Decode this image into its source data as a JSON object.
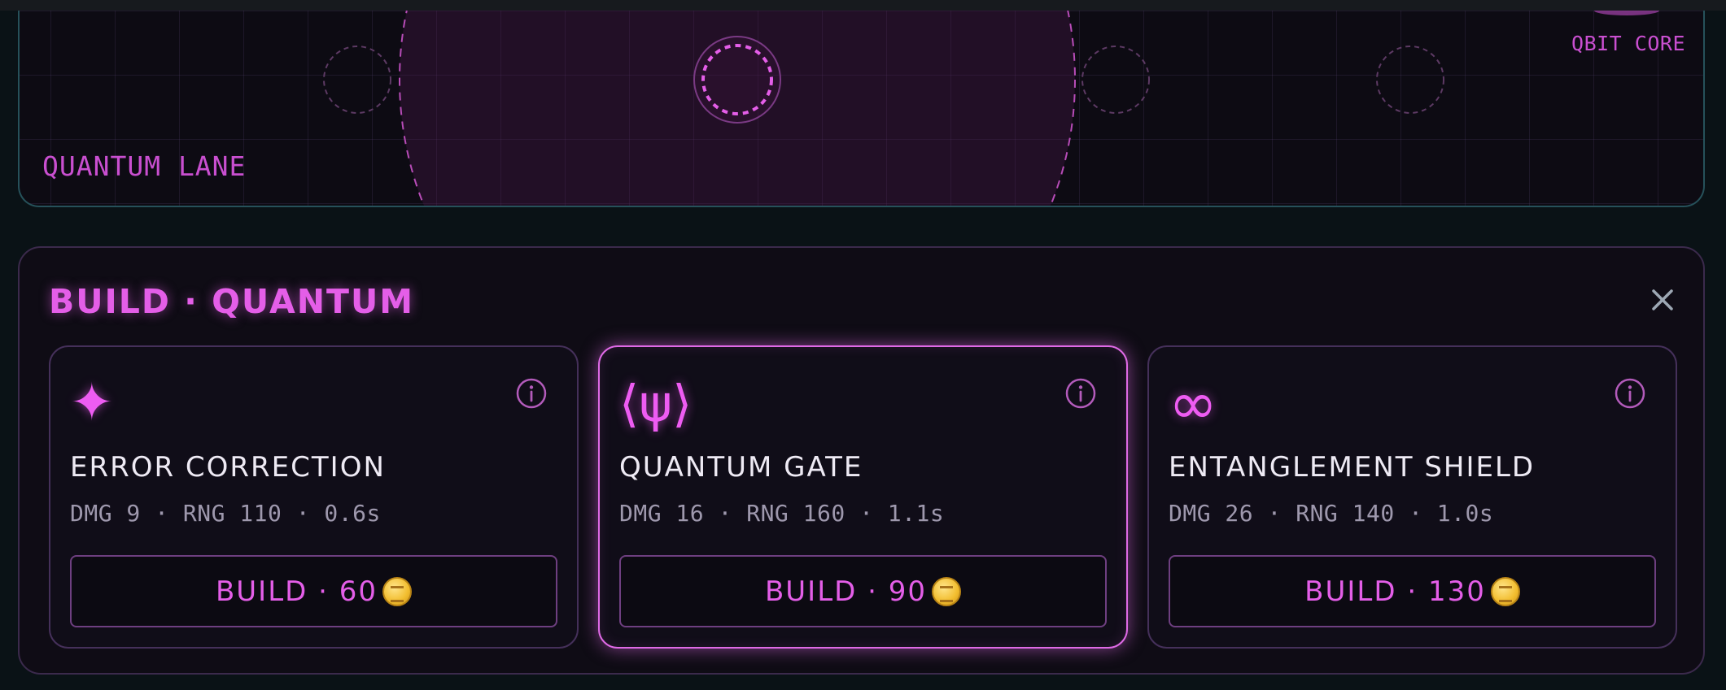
{
  "lane": {
    "label": "QUANTUM LANE",
    "core_label": "QBIT CORE"
  },
  "panel": {
    "title": "BUILD · QUANTUM",
    "close_icon": "close-icon",
    "cards": [
      {
        "icon": "✦",
        "icon_name": "sparkle-icon",
        "name": "ERROR CORRECTION",
        "stats": "DMG 9 · RNG 110 · 0.6s",
        "build_label": "BUILD · 60",
        "selected": false
      },
      {
        "icon": "⟨ψ⟩",
        "icon_name": "psi-ket-icon",
        "name": "QUANTUM GATE",
        "stats": "DMG 16 · RNG 160 · 1.1s",
        "build_label": "BUILD · 90",
        "selected": true
      },
      {
        "icon": "∞",
        "icon_name": "infinity-icon",
        "name": "ENTANGLEMENT SHIELD",
        "stats": "DMG 26 · RNG 140 · 1.0s",
        "build_label": "BUILD · 130",
        "selected": false
      }
    ]
  },
  "colors": {
    "accent": "#e45ee8",
    "lane_border": "#26515a",
    "panel_bg": "#0f0c15",
    "text_primary": "#eeeaf4",
    "text_muted": "#9e98ad",
    "coin": "#f2bd2e"
  }
}
